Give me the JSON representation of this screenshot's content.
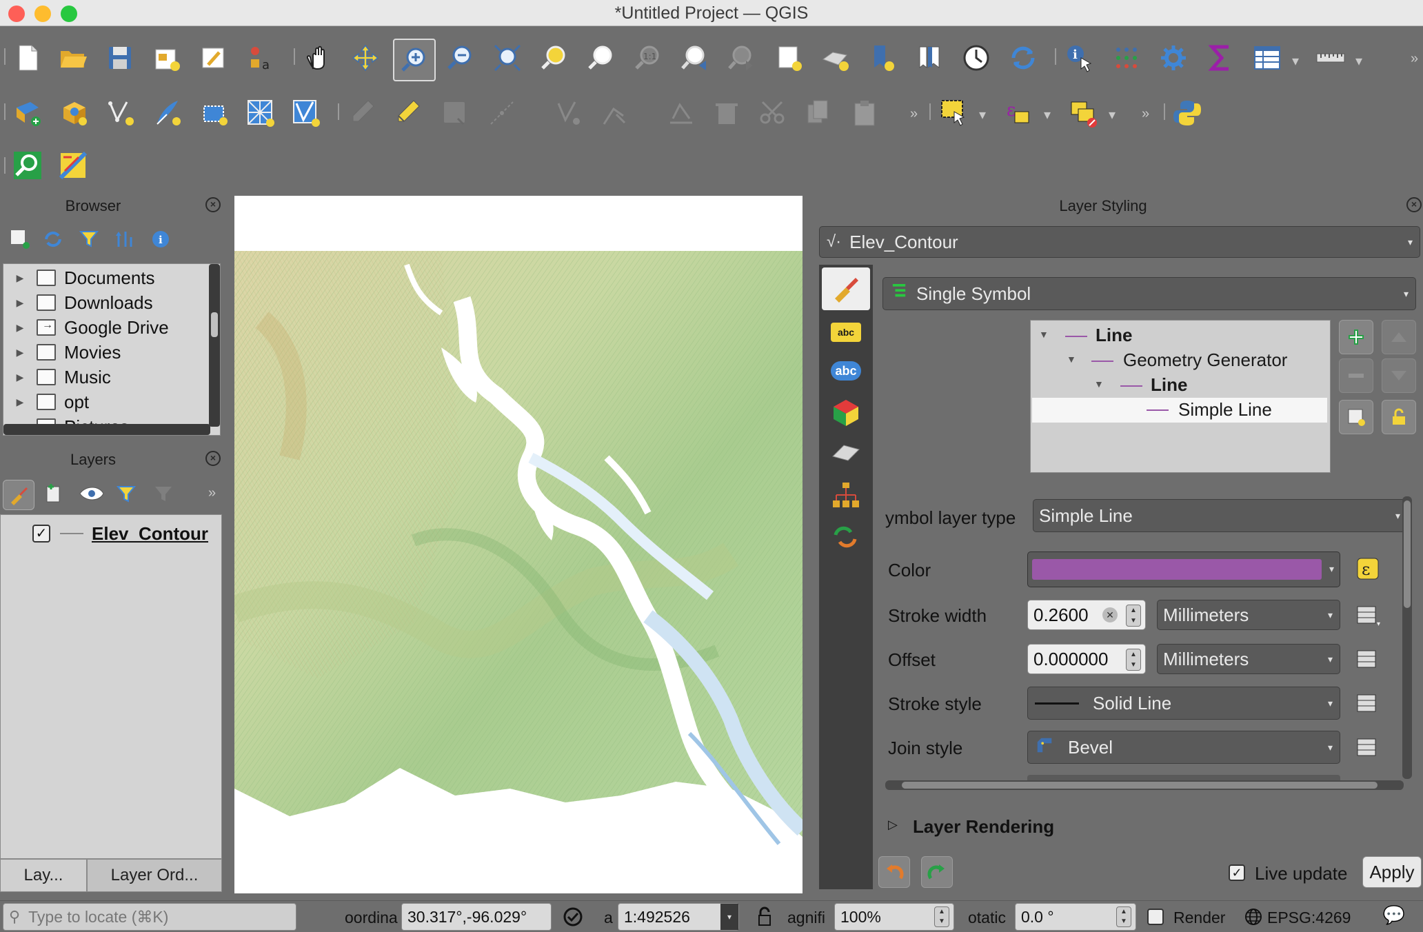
{
  "window": {
    "title": "*Untitled Project — QGIS",
    "colors": {
      "close": "#fe5f57",
      "minimize": "#febc2e",
      "maximize": "#28c840"
    }
  },
  "toolbar_row1": [
    "new-project-icon",
    "open-project-icon",
    "save-project-icon",
    "print-layout-icon",
    "layout-manager-icon",
    "style-manager-icon",
    "pan-icon",
    "pan-to-selection-icon",
    "zoom-in-icon",
    "zoom-out-icon",
    "zoom-full-icon",
    "zoom-to-selection-icon",
    "zoom-to-layer-icon",
    "zoom-native-icon",
    "zoom-last-icon",
    "zoom-next-icon",
    "new-bookmark-icon",
    "show-bookmarks-icon",
    "new-spatial-bookmark-icon",
    "temporal-controller-icon",
    "refresh-icon",
    "identify-icon",
    "attribute-table-icon",
    "settings-icon",
    "statistics-icon",
    "open-table-icon",
    "measure-icon"
  ],
  "toolbar_row2": [
    "data-source-manager-icon",
    "new-geopackage-icon",
    "new-shapefile-icon",
    "new-scratch-layer-icon",
    "new-virtual-layer-icon",
    "new-mesh-layer-icon",
    "new-temp-layer-icon",
    "toggle-editing-icon",
    "current-edits-icon",
    "save-edits-icon",
    "digitize-icon",
    "vertex-tool-icon",
    "cut-icon",
    "copy-icon",
    "paste-icon",
    "select-icon",
    "select-expression-icon",
    "deselect-icon",
    "python-icon"
  ],
  "browser": {
    "title": "Browser",
    "items": [
      {
        "label": "Documents"
      },
      {
        "label": "Downloads"
      },
      {
        "label": "Google Drive"
      },
      {
        "label": "Movies"
      },
      {
        "label": "Music"
      },
      {
        "label": "opt"
      },
      {
        "label": "Pictures"
      }
    ]
  },
  "layers": {
    "title": "Layers",
    "items": [
      {
        "label": "Elev_Contour",
        "checked": true
      }
    ],
    "tabs": [
      "Lay...",
      "Layer Ord..."
    ]
  },
  "styling": {
    "title": "Layer Styling",
    "layer": "Elev_Contour",
    "renderer": "Single Symbol",
    "tree": [
      {
        "label": "Line"
      },
      {
        "label": "Geometry Generator"
      },
      {
        "label": "Line"
      },
      {
        "label": "Simple Line"
      }
    ],
    "symbol_layer_type_label": "ymbol layer type",
    "symbol_layer_type": "Simple Line",
    "color_label": "Color",
    "color_value": "#9a58a8",
    "stroke_width_label": "Stroke width",
    "stroke_width": "0.2600",
    "stroke_width_unit": "Millimeters",
    "offset_label": "Offset",
    "offset": "0.000000",
    "offset_unit": "Millimeters",
    "stroke_style_label": "Stroke style",
    "stroke_style": "Solid Line",
    "join_style_label": "Join style",
    "join_style": "Bevel",
    "layer_rendering": "Layer Rendering",
    "live_update": "Live update",
    "apply": "Apply"
  },
  "statusbar": {
    "locate_placeholder": "Type to locate (⌘K)",
    "coord_label": "oordina",
    "coord_value": "30.317°,-96.029°",
    "scale_label": "a",
    "scale_value": "1:492526",
    "magnifier_label": "agnifi",
    "magnifier_value": "100%",
    "rotation_label": "otatic",
    "rotation_value": "0.0 °",
    "render_label": "Render",
    "crs": "EPSG:4269"
  }
}
